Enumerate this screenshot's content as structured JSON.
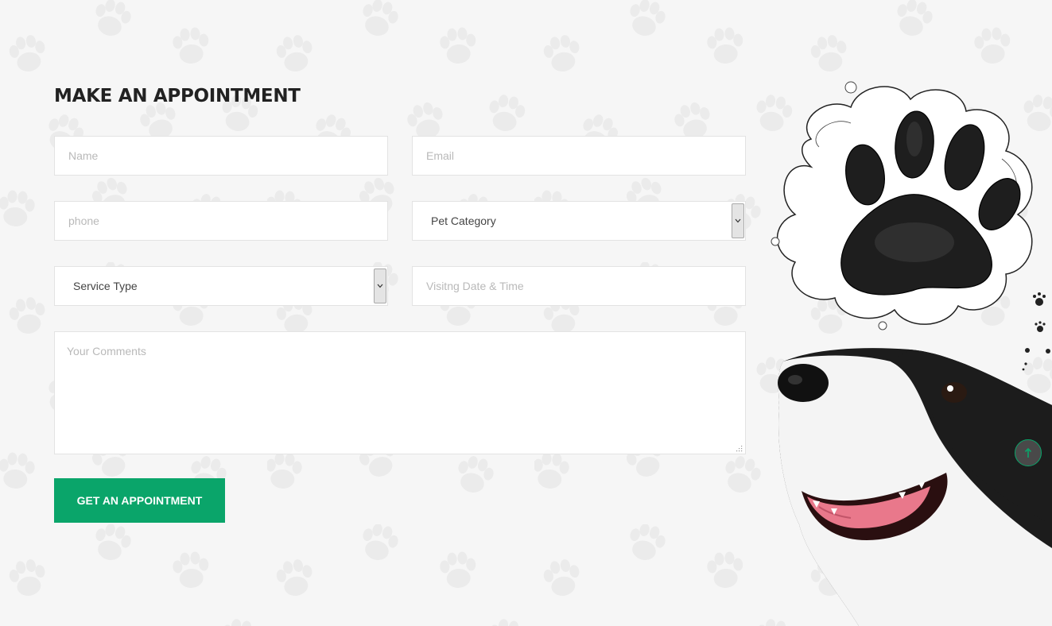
{
  "form": {
    "title": "MAKE AN APPOINTMENT",
    "name_placeholder": "Name",
    "email_placeholder": "Email",
    "phone_placeholder": "phone",
    "pet_category_selected": "Pet Category",
    "service_type_selected": "Service Type",
    "visit_placeholder": "Visitng Date & Time",
    "comments_placeholder": "Your Comments",
    "submit_label": "GET AN APPOINTMENT"
  },
  "colors": {
    "accent": "#0aa56a",
    "background": "#f6f6f6",
    "heading": "#222222"
  },
  "icons": {
    "scroll_top": "arrow-up-icon",
    "select_arrow": "chevron-down-icon"
  }
}
